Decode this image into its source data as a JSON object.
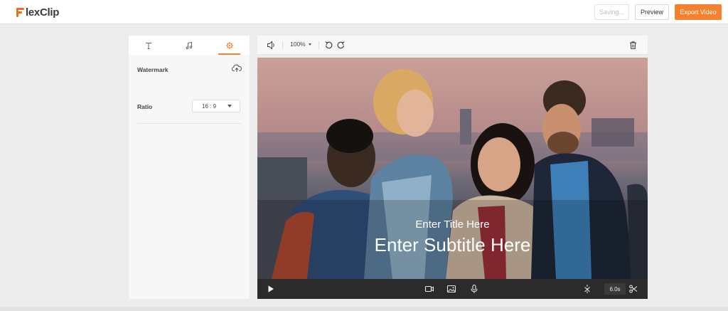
{
  "app": {
    "logo_text": "lexClip",
    "accent_color": "#f5812e"
  },
  "header": {
    "saving_label": "Saving...",
    "preview_label": "Preview",
    "export_label": "Export Video"
  },
  "panel": {
    "tabs": [
      {
        "icon": "text-icon"
      },
      {
        "icon": "music-icon"
      },
      {
        "icon": "gear-icon",
        "active": true
      }
    ],
    "watermark_label": "Watermark",
    "ratio_label": "Ratio",
    "ratio_value": "16 : 9"
  },
  "editor": {
    "zoom_label": "100%",
    "title_text": "Enter Title Here",
    "subtitle_text": "Enter Subtitle Here"
  },
  "player": {
    "duration": "6.0s"
  }
}
